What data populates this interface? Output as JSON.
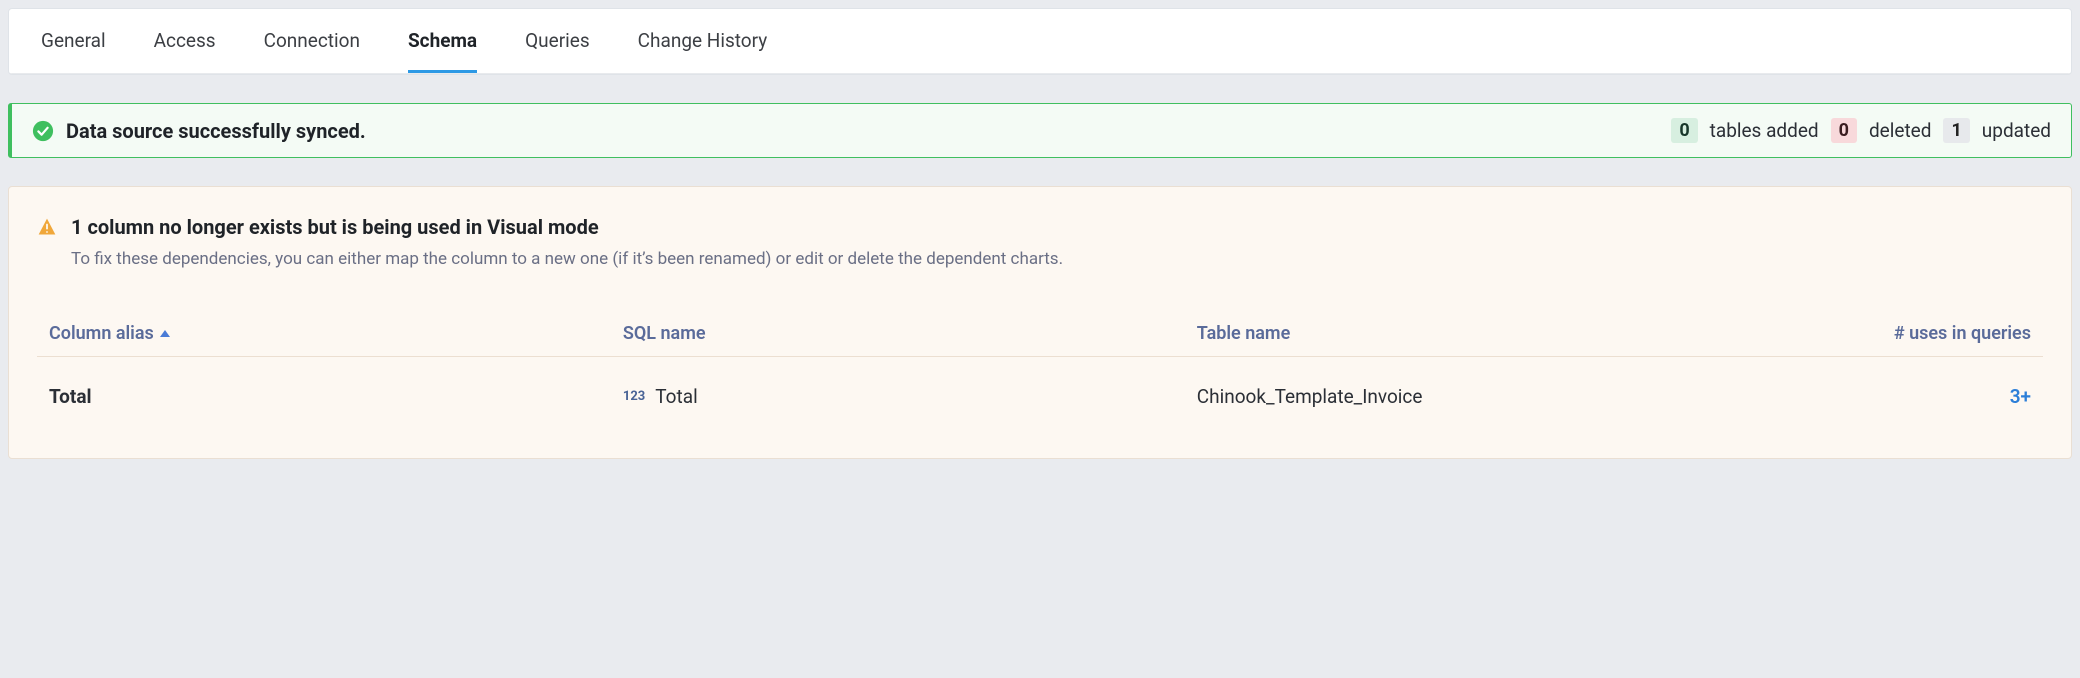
{
  "tabs": {
    "items": [
      {
        "label": "General",
        "active": false
      },
      {
        "label": "Access",
        "active": false
      },
      {
        "label": "Connection",
        "active": false
      },
      {
        "label": "Schema",
        "active": true
      },
      {
        "label": "Queries",
        "active": false
      },
      {
        "label": "Change History",
        "active": false
      }
    ]
  },
  "sync_banner": {
    "message": "Data source successfully synced.",
    "stats": {
      "added_count": "0",
      "added_label": "tables added",
      "deleted_count": "0",
      "deleted_label": "deleted",
      "updated_count": "1",
      "updated_label": "updated"
    }
  },
  "warning": {
    "title": "1 column no longer exists but is being used in Visual mode",
    "subtitle": "To fix these dependencies, you can either map the column to a new one (if it’s been renamed) or edit or delete the dependent charts."
  },
  "table": {
    "headers": {
      "alias": "Column alias",
      "sql": "SQL name",
      "table": "Table name",
      "uses": "# uses in queries"
    },
    "sort_column": "alias",
    "sort_direction": "asc",
    "rows": [
      {
        "alias": "Total",
        "type_badge": "123",
        "sql_name": "Total",
        "table_name": "Chinook_Template_Invoice",
        "uses": "3+"
      }
    ]
  }
}
